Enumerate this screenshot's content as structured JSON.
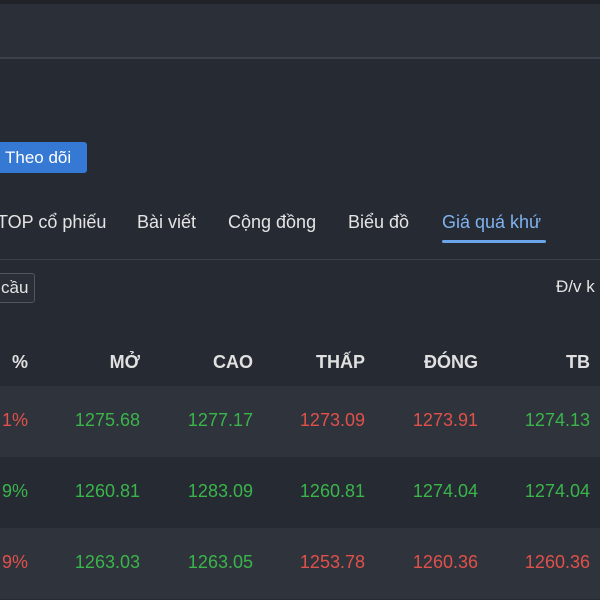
{
  "follow_button": {
    "label": "Theo dõi"
  },
  "tabs": [
    {
      "label": "TOP cổ phiếu",
      "active": false
    },
    {
      "label": "Bài viết",
      "active": false
    },
    {
      "label": "Cộng đồng",
      "active": false
    },
    {
      "label": "Biểu đồ",
      "active": false
    },
    {
      "label": "Giá quá khứ",
      "active": true
    }
  ],
  "filter": {
    "label": "cầu"
  },
  "unit": {
    "label": "Đ/v k"
  },
  "table": {
    "headers": [
      "%",
      "MỞ",
      "CAO",
      "THẤP",
      "ĐÓNG",
      "TB"
    ],
    "rows": [
      {
        "pct": "1%",
        "open": "1275.68",
        "high": "1277.17",
        "low": "1273.09",
        "close": "1273.91",
        "avg": "1274.13",
        "colors": [
          "down",
          "up",
          "up",
          "down",
          "down",
          "up"
        ]
      },
      {
        "pct": "9%",
        "open": "1260.81",
        "high": "1283.09",
        "low": "1260.81",
        "close": "1274.04",
        "avg": "1274.04",
        "colors": [
          "up",
          "up",
          "up",
          "up",
          "up",
          "up"
        ]
      },
      {
        "pct": "9%",
        "open": "1263.03",
        "high": "1263.05",
        "low": "1253.78",
        "close": "1260.36",
        "avg": "1260.36",
        "colors": [
          "down",
          "up",
          "up",
          "down",
          "down",
          "down"
        ]
      }
    ]
  },
  "colors": {
    "up": "#3ab54a",
    "down": "#e0514a",
    "accent": "#3579d4",
    "tab_active": "#7fb2ee"
  }
}
